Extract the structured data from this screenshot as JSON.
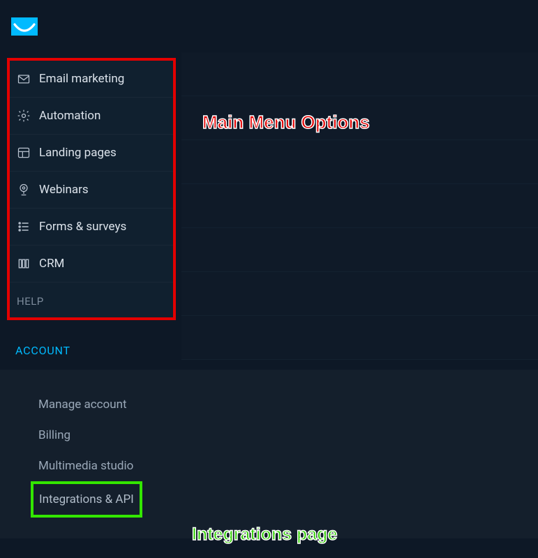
{
  "menu": {
    "items": [
      {
        "label": "Email marketing",
        "icon": "mail-icon"
      },
      {
        "label": "Automation",
        "icon": "gear-icon"
      },
      {
        "label": "Landing pages",
        "icon": "layout-icon"
      },
      {
        "label": "Webinars",
        "icon": "webcam-icon"
      },
      {
        "label": "Forms & surveys",
        "icon": "list-icon"
      },
      {
        "label": "CRM",
        "icon": "columns-icon"
      }
    ],
    "help": "HELP"
  },
  "account": {
    "header": "ACCOUNT",
    "items": [
      "Manage account",
      "Billing",
      "Multimedia studio",
      "Integrations & API"
    ]
  },
  "annotations": {
    "main_menu": "Main Menu Options",
    "integrations": "Integrations page"
  }
}
